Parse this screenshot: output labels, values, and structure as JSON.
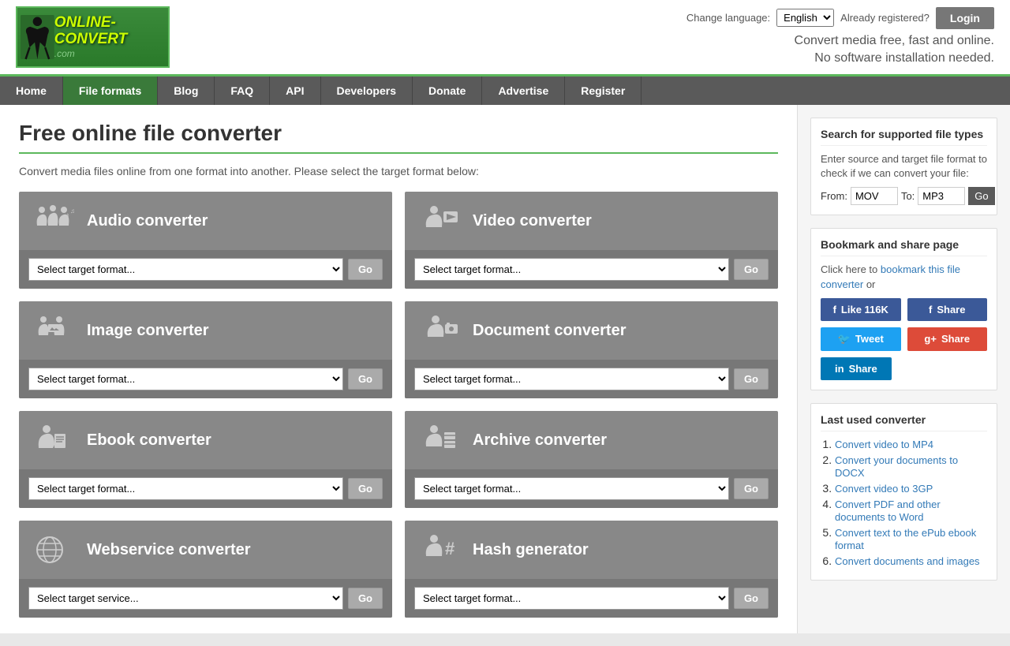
{
  "header": {
    "logo_alt": "Online-Convert.com",
    "tagline_line1": "Convert media free, fast and online.",
    "tagline_line2": "No software installation needed.",
    "lang_label": "Change language:",
    "lang_value": "English",
    "already_reg": "Already registered?",
    "login_label": "Login"
  },
  "nav": {
    "items": [
      {
        "label": "Home",
        "active": false
      },
      {
        "label": "File formats",
        "active": true
      },
      {
        "label": "Blog",
        "active": false
      },
      {
        "label": "FAQ",
        "active": false
      },
      {
        "label": "API",
        "active": false
      },
      {
        "label": "Developers",
        "active": false
      },
      {
        "label": "Donate",
        "active": false
      },
      {
        "label": "Advertise",
        "active": false
      },
      {
        "label": "Register",
        "active": false
      }
    ]
  },
  "content": {
    "page_title": "Free online file converter",
    "subtitle": "Convert media files online from one format into another. Please select the target format below:",
    "converters": [
      {
        "id": "audio",
        "title": "Audio converter",
        "select_placeholder": "Select target format...",
        "go_label": "Go"
      },
      {
        "id": "video",
        "title": "Video converter",
        "select_placeholder": "Select target format...",
        "go_label": "Go"
      },
      {
        "id": "image",
        "title": "Image converter",
        "select_placeholder": "Select target format...",
        "go_label": "Go"
      },
      {
        "id": "document",
        "title": "Document converter",
        "select_placeholder": "Select target format...",
        "go_label": "Go"
      },
      {
        "id": "ebook",
        "title": "Ebook converter",
        "select_placeholder": "Select target format...",
        "go_label": "Go"
      },
      {
        "id": "archive",
        "title": "Archive converter",
        "select_placeholder": "Select target format...",
        "go_label": "Go"
      },
      {
        "id": "webservice",
        "title": "Webservice converter",
        "select_placeholder": "Select target service...",
        "go_label": "Go"
      },
      {
        "id": "hash",
        "title": "Hash generator",
        "select_placeholder": "Select target format...",
        "go_label": "Go"
      }
    ]
  },
  "sidebar": {
    "search_section": {
      "title": "Search for supported file types",
      "description": "Enter source and target file format to check if we can convert your file:",
      "from_label": "From:",
      "from_placeholder": "MOV",
      "to_label": "To:",
      "to_placeholder": "MP3",
      "go_label": "Go"
    },
    "bookmark_section": {
      "title": "Bookmark and share page",
      "text_before": "Click here to ",
      "link_text": "bookmark this file converter",
      "text_after": " or",
      "fb_like": "Like 116K",
      "fb_share": "Share",
      "tweet": "Tweet",
      "gplus_share": "Share",
      "linkedin": "Share"
    },
    "last_used": {
      "title": "Last used converter",
      "items": [
        {
          "label": "Convert video to MP4",
          "href": "#"
        },
        {
          "label": "Convert your documents to DOCX",
          "href": "#"
        },
        {
          "label": "Convert video to 3GP",
          "href": "#"
        },
        {
          "label": "Convert PDF and other documents to Word",
          "href": "#"
        },
        {
          "label": "Convert text to the ePub ebook format",
          "href": "#"
        },
        {
          "label": "Convert documents and images",
          "href": "#"
        }
      ]
    }
  }
}
